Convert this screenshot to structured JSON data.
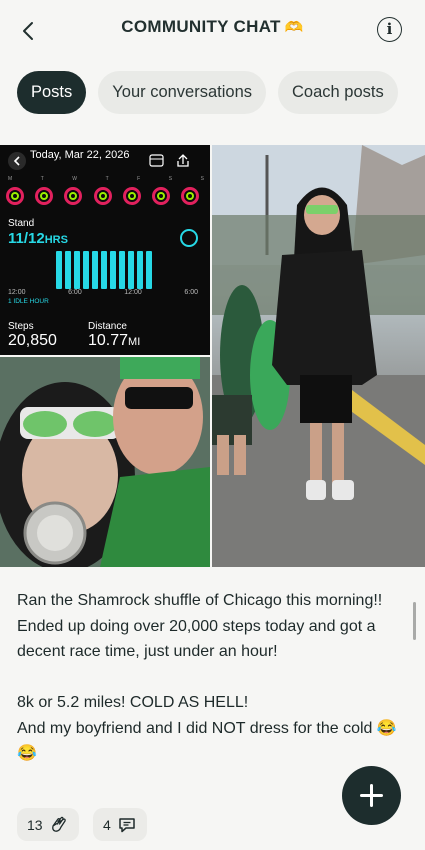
{
  "header": {
    "title": "COMMUNITY CHAT",
    "title_emoji": "🫶",
    "info_label": "i"
  },
  "tabs": [
    {
      "label": "Posts",
      "active": true
    },
    {
      "label": "Your conversations",
      "active": false
    },
    {
      "label": "Coach posts",
      "active": false
    }
  ],
  "fitness": {
    "date": "Today, Mar 22, 2026",
    "days": [
      "M",
      "T",
      "W",
      "T",
      "F",
      "S",
      "S"
    ],
    "stand_label": "Stand",
    "stand_value": "11/12",
    "stand_unit": "HRS",
    "axis": [
      "12:00",
      "6:00",
      "12:00",
      "6:00"
    ],
    "idle": "1 IDLE HOUR",
    "steps_label": "Steps",
    "steps_value": "20,850",
    "distance_label": "Distance",
    "distance_value": "10.77",
    "distance_unit": "MI"
  },
  "post": {
    "lines": [
      "Ran the Shamrock shuffle of Chicago this morning!!",
      "Ended up doing over 20,000 steps today and got a decent race time, just under an hour!",
      "8k or 5.2 miles! COLD AS HELL!",
      "And my boyfriend and I did NOT dress for the cold 😂😂"
    ]
  },
  "reactions": {
    "claps": "13",
    "comments": "4"
  },
  "colors": {
    "primary_dark": "#1d2d2d",
    "chip_bg": "#ebebe8",
    "page_bg": "#f6f6f4",
    "fitness_cyan": "#27d9e6"
  }
}
